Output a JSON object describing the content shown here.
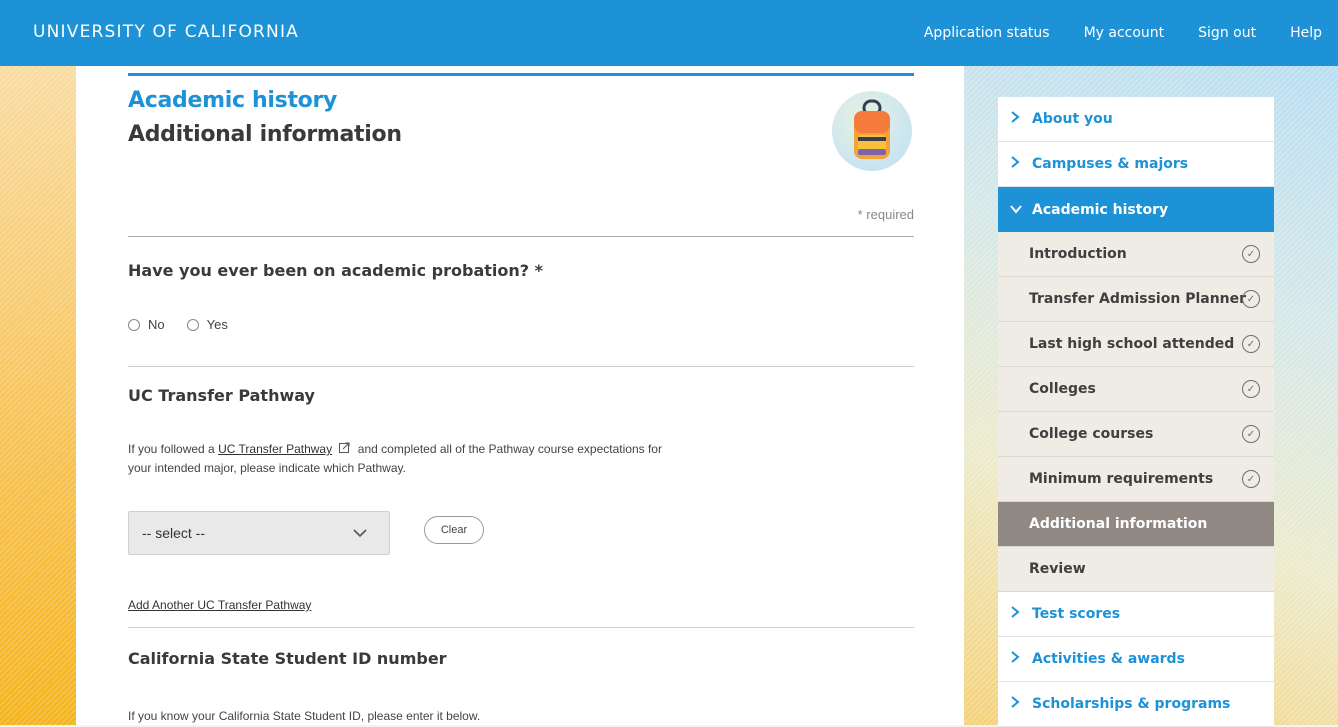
{
  "header": {
    "brand": "UNIVERSITY OF CALIFORNIA",
    "nav": [
      "Application status",
      "My account",
      "Sign out",
      "Help"
    ]
  },
  "page": {
    "section_title": "Academic history",
    "page_title": "Additional information",
    "required_note": "* required"
  },
  "probation": {
    "question": "Have you ever been on academic probation? *",
    "options": [
      "No",
      "Yes"
    ]
  },
  "pathway": {
    "heading": "UC Transfer Pathway",
    "desc_before": "If you followed a",
    "link_text": "UC Transfer Pathway",
    "desc_after": "and completed all of the Pathway course expectations for your intended major, please indicate which Pathway.",
    "select_value": "-- select --",
    "clear_label": "Clear",
    "add_link": "Add Another UC Transfer Pathway"
  },
  "state_id": {
    "heading": "California State Student ID number",
    "desc": "If you know your California State Student ID, please enter it below."
  },
  "sidebar": {
    "top_items": [
      "About you",
      "Campuses & majors"
    ],
    "active_section": "Academic history",
    "sub_items": [
      {
        "label": "Introduction",
        "done": true
      },
      {
        "label": "Transfer Admission Planner",
        "done": true
      },
      {
        "label": "Last high school attended",
        "done": true
      },
      {
        "label": "Colleges",
        "done": true
      },
      {
        "label": "College courses",
        "done": true
      },
      {
        "label": "Minimum requirements",
        "done": true
      },
      {
        "label": "Additional information",
        "done": false
      },
      {
        "label": "Review",
        "done": false
      }
    ],
    "bottom_items": [
      "Test scores",
      "Activities & awards",
      "Scholarships & programs"
    ]
  },
  "colors": {
    "accent": "#1d92d6",
    "sidebar_current": "#8f8883",
    "sidebar_sub_bg": "#efebe5"
  }
}
